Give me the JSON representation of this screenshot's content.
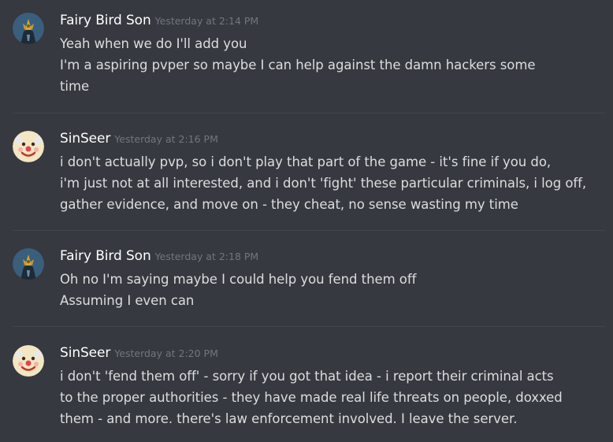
{
  "messages": [
    {
      "author": "Fairy Bird Son",
      "timestamp": "Yesterday at 2:14 PM",
      "avatar": "bird-avatar",
      "lines": [
        "Yeah when we do I'll add you",
        "I'm a aspiring pvper so maybe I can help against the damn hackers some",
        "time"
      ]
    },
    {
      "author": "SinSeer",
      "timestamp": "Yesterday at 2:16 PM",
      "avatar": "clown-avatar",
      "lines": [
        "i don't actually pvp, so i don't play that part of the game - it's fine if you do,",
        "i'm just not at all interested, and i don't 'fight' these particular criminals, i log off,",
        "gather evidence, and move on - they cheat, no sense wasting my time"
      ]
    },
    {
      "author": "Fairy Bird Son",
      "timestamp": "Yesterday at 2:18 PM",
      "avatar": "bird-avatar",
      "lines": [
        "Oh no I'm saying maybe I could help you fend them off",
        "Assuming I even can"
      ]
    },
    {
      "author": "SinSeer",
      "timestamp": "Yesterday at 2:20 PM",
      "avatar": "clown-avatar",
      "lines": [
        "i don't 'fend them off' - sorry if you got that idea - i report their criminal acts",
        "to the proper authorities - they have made real life threats on people, doxxed",
        "them - and more. there's law enforcement involved. I leave the server."
      ]
    }
  ]
}
